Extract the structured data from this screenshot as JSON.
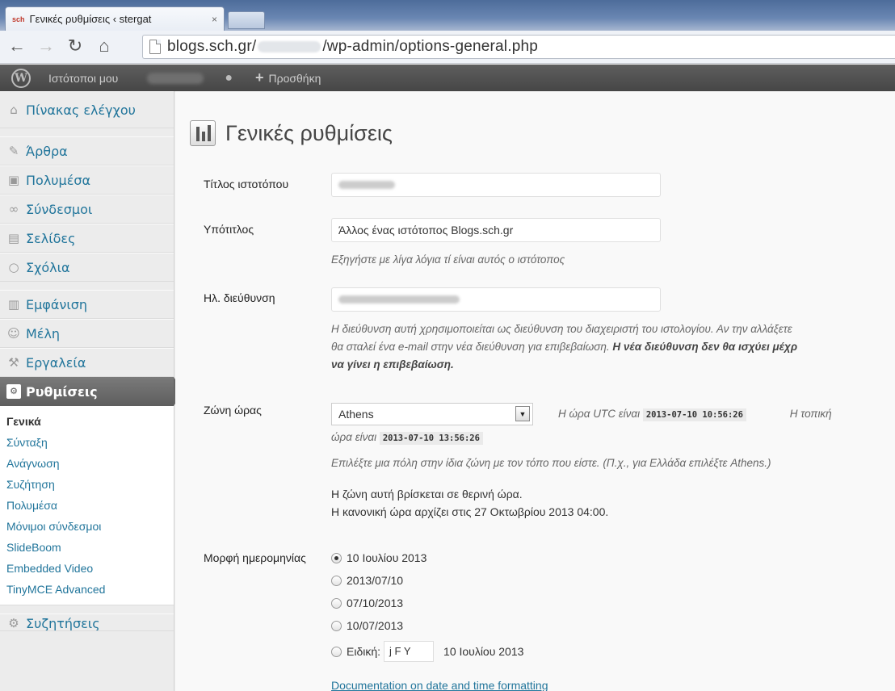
{
  "browser": {
    "tab_title": "Γενικές ρυθμίσεις ‹ stergat",
    "tab_favicon": "sch",
    "tab_close": "×",
    "url_prefix": "blogs.sch.gr/",
    "url_suffix": "/wp-admin/options-general.php"
  },
  "adminbar": {
    "my_sites": "Ιστότοποι μου",
    "add_new": "Προσθήκη",
    "plus": "+"
  },
  "sidebar": {
    "items": [
      {
        "label": "Πίνακας ελέγχου",
        "icon": "home-icon"
      },
      {
        "label": "Άρθρα",
        "icon": "pin-icon"
      },
      {
        "label": "Πολυμέσα",
        "icon": "media-icon"
      },
      {
        "label": "Σύνδεσμοι",
        "icon": "link-icon"
      },
      {
        "label": "Σελίδες",
        "icon": "page-icon"
      },
      {
        "label": "Σχόλια",
        "icon": "comment-icon"
      },
      {
        "label": "Εμφάνιση",
        "icon": "appearance-icon"
      },
      {
        "label": "Μέλη",
        "icon": "users-icon"
      },
      {
        "label": "Εργαλεία",
        "icon": "tools-icon"
      },
      {
        "label": "Ρυθμίσεις",
        "icon": "settings-icon"
      }
    ],
    "submenu": [
      "Γενικά",
      "Σύνταξη",
      "Ανάγνωση",
      "Συζήτηση",
      "Πολυμέσα",
      "Μόνιμοι σύνδεσμοι",
      "SlideBoom",
      "Embedded Video",
      "TinyMCE Advanced"
    ],
    "next_item": "Συζητήσεις"
  },
  "main": {
    "title": "Γενικές ρυθμίσεις",
    "site_title_label": "Τίτλος ιστοτόπου",
    "tagline_label": "Υπότιτλος",
    "tagline_value": "Άλλος ένας ιστότοπος Blogs.sch.gr",
    "tagline_desc": "Εξηγήστε με λίγα λόγια τί είναι αυτός ο ιστότοπος",
    "email_label": "Ηλ. διεύθυνση",
    "email_desc_1": "Η διεύθυνση αυτή χρησιμοποιείται ως διεύθυνση του διαχειριστή του ιστολογίου. Αν την αλλάξετε",
    "email_desc_2a": "θα σταλεί ένα e-mail στην νέα διεύθυνση για επιβεβαίωση. ",
    "email_desc_2b": "Η νέα διεύθυνση δεν θα ισχύει μέχρ",
    "email_desc_3": "να γίνει η επιβεβαίωση.",
    "timezone_label": "Ζώνη ώρας",
    "timezone_value": "Athens",
    "utc_text": "Η ώρα UTC είναι",
    "utc_time": "2013-07-10 10:56:26",
    "local_text_1": "Η τοπική",
    "local_text_2": "ώρα είναι",
    "local_time": "2013-07-10 13:56:26",
    "tz_hint": "Επιλέξτε μια πόλη στην ίδια ζώνη με τον τόπο που είστε. (Π.χ., για Ελλάδα επιλέξτε Athens.)",
    "dst_1": "Η ζώνη αυτή βρίσκεται σε θερινή ώρα.",
    "dst_2": "Η κανονική ώρα αρχίζει στις 27 Οκτωβρίου 2013 04:00.",
    "date_format_label": "Μορφή ημερομηνίας",
    "date_formats": [
      "10 Ιουλίου 2013",
      "2013/07/10",
      "07/10/2013",
      "10/07/2013"
    ],
    "custom_label": "Ειδική:",
    "custom_value": "j F Y",
    "custom_preview": "10 Ιουλίου 2013",
    "doc_link": "Documentation on date and time formatting"
  }
}
